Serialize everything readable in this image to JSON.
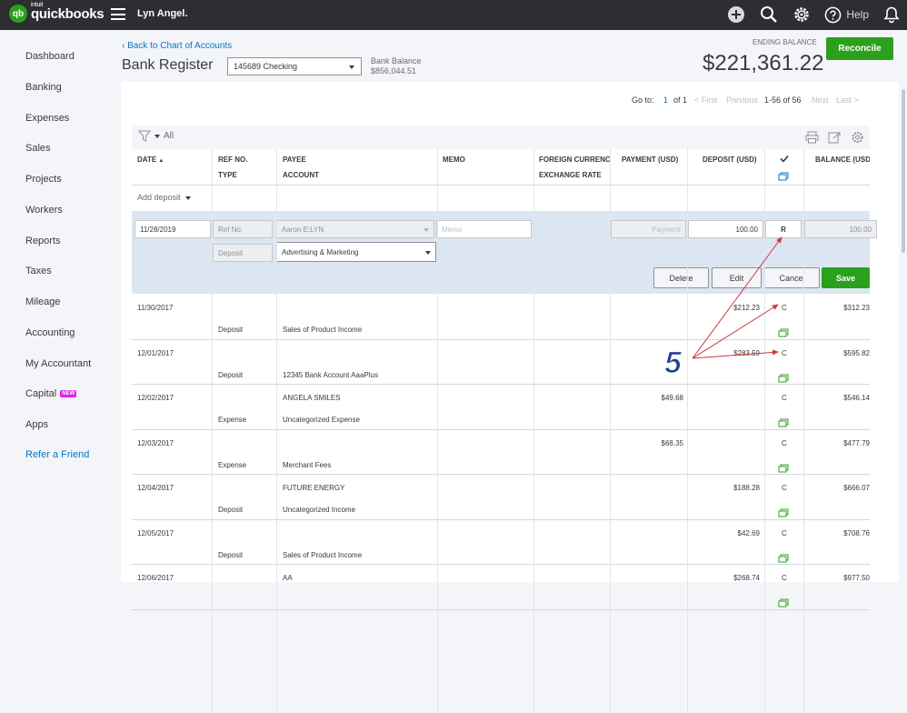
{
  "header": {
    "logo_top": "intuit",
    "logo_brand": "quickbooks",
    "logo_mark": "qb",
    "company": "Lyn Angel.",
    "help": "Help"
  },
  "sidebar": {
    "items": [
      "Dashboard",
      "Banking",
      "Expenses",
      "Sales",
      "Projects",
      "Workers",
      "Reports",
      "Taxes",
      "Mileage",
      "Accounting",
      "My Accountant",
      "Capital",
      "Apps"
    ],
    "capital_badge": "NEW",
    "refer": "Refer a Friend"
  },
  "page": {
    "back_link": "Back to Chart of Accounts",
    "title": "Bank Register",
    "account": "145689 Checking",
    "bank_balance_label": "Bank Balance",
    "bank_balance": "$856,044.51",
    "ending_label": "ENDING BALANCE",
    "ending_balance": "$221,361.22",
    "reconcile": "Reconcile"
  },
  "pager": {
    "goto": "Go to:",
    "page": "1",
    "of": "of 1",
    "first": "< First",
    "previous": "Previous",
    "range": "1-56 of 56",
    "next": "Next",
    "last": "Last >"
  },
  "toolbar": {
    "filter_label": "All"
  },
  "columns": {
    "date": "DATE",
    "ref": "REF NO.",
    "type": "TYPE",
    "payee": "PAYEE",
    "account": "ACCOUNT",
    "memo": "MEMO",
    "foreign": "FOREIGN CURRENCY",
    "exchange": "EXCHANGE RATE",
    "payment": "PAYMENT (USD)",
    "deposit": "DEPOSIT (USD)",
    "balance": "BALANCE (USD)"
  },
  "add_deposit": "Add deposit",
  "edit": {
    "date": "11/28/2019",
    "ref_placeholder": "Ref No.",
    "payee": "Aaron E:LYN",
    "memo_placeholder": "Memo",
    "payment_placeholder": "Payment",
    "deposit": "100.00",
    "status": "R",
    "balance": "100.00",
    "type": "Deposit",
    "account": "Advertising & Marketing",
    "buttons": {
      "delete": "Delete",
      "edit": "Edit",
      "cancel": "Cancel",
      "save": "Save"
    }
  },
  "rows": [
    {
      "date": "11/30/2017",
      "type": "Deposit",
      "payee": "",
      "account": "Sales of Product Income",
      "payment": "",
      "deposit": "$212.23",
      "status": "C",
      "balance": "$312.23"
    },
    {
      "date": "12/01/2017",
      "type": "Deposit",
      "payee": "",
      "account": "12345 Bank Account AaaPlus",
      "payment": "",
      "deposit": "$283.59",
      "status": "C",
      "balance": "$595.82"
    },
    {
      "date": "12/02/2017",
      "type": "Expense",
      "payee": "ANGELA SMILES",
      "account": "Uncategorized Expense",
      "payment": "$49.68",
      "deposit": "",
      "status": "C",
      "balance": "$546.14"
    },
    {
      "date": "12/03/2017",
      "type": "Expense",
      "payee": "",
      "account": "Merchant Fees",
      "payment": "$68.35",
      "deposit": "",
      "status": "C",
      "balance": "$477.79"
    },
    {
      "date": "12/04/2017",
      "type": "Deposit",
      "payee": "FUTURE ENERGY",
      "account": "Uncategorized Income",
      "payment": "",
      "deposit": "$188.28",
      "status": "C",
      "balance": "$666.07"
    },
    {
      "date": "12/05/2017",
      "type": "Deposit",
      "payee": "",
      "account": "Sales of Product Income",
      "payment": "",
      "deposit": "$42.69",
      "status": "C",
      "balance": "$708.76"
    },
    {
      "date": "12/06/2017",
      "type": "",
      "payee": "AA",
      "account": "",
      "payment": "",
      "deposit": "$268.74",
      "status": "C",
      "balance": "$977.50"
    }
  ],
  "annotation": {
    "number": "5",
    "color": "#1f3f8f",
    "arrow_color": "#d0363b"
  },
  "colors": {
    "brand_green": "#2ca01c",
    "link_blue": "#0077c5",
    "topbar": "#2d2e31"
  }
}
